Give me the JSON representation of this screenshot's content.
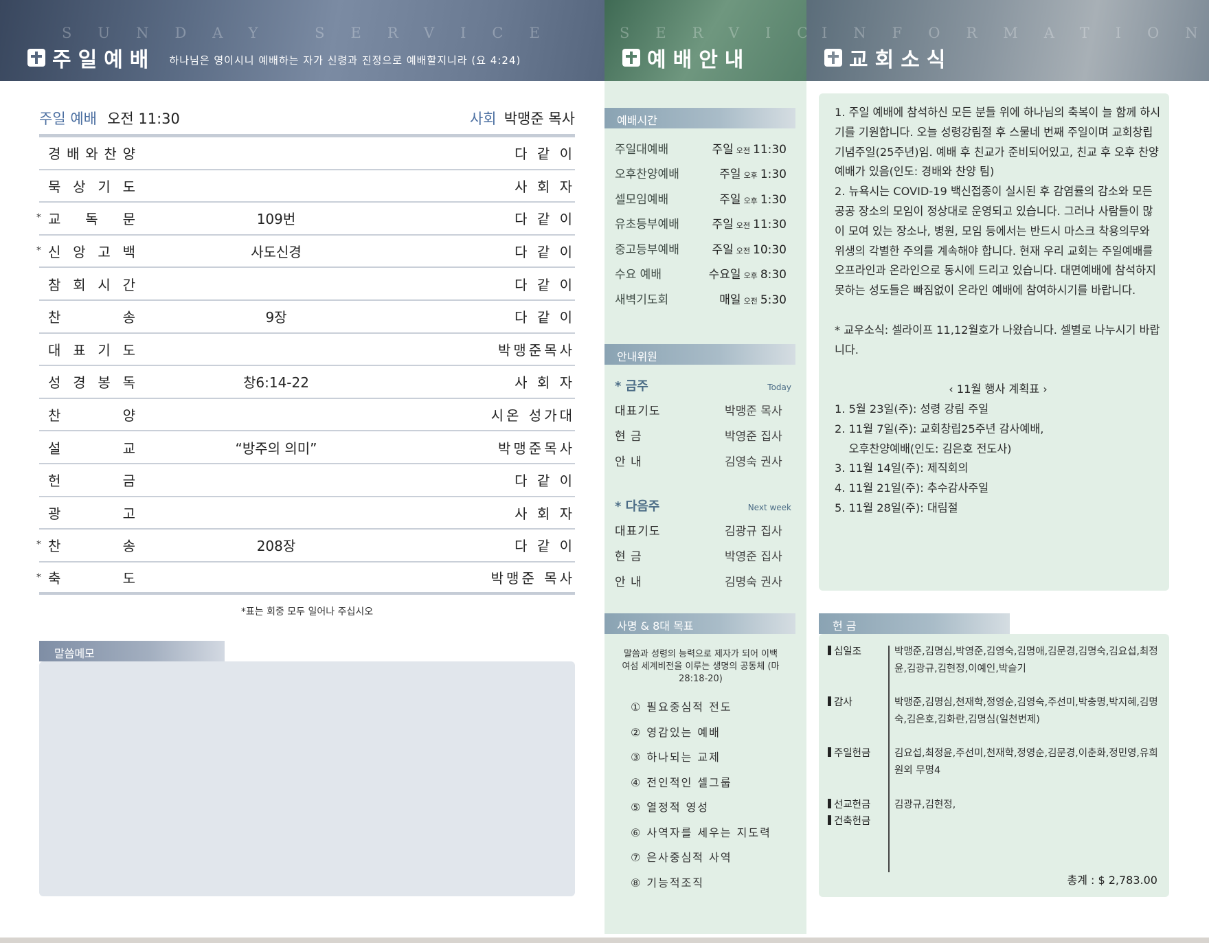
{
  "header": {
    "worship": {
      "deco": "SUNDAY SERVICE",
      "title": "주일예배",
      "subtitle": "하나님은 영이시니 예배하는 자가 신령과 진정으로 예배할지니라 (요 4:24)"
    },
    "guide": {
      "deco": "SERVICE",
      "title": "예배안내"
    },
    "news": {
      "deco": "INFORMATION",
      "title": "교회소식"
    }
  },
  "worship": {
    "service_label": "주일 예배",
    "service_time": "오전 11:30",
    "host_label": "사회",
    "host_name": "박맹준 목사",
    "order": [
      {
        "star": "",
        "name": [
          "경",
          "배",
          "와",
          " 찬",
          "양"
        ],
        "mid": "",
        "right": "다 같 이"
      },
      {
        "star": "",
        "name": [
          "묵",
          "상",
          "기",
          "도"
        ],
        "mid": "",
        "right": "사 회 자"
      },
      {
        "star": "*",
        "name": [
          "교",
          "독",
          "문"
        ],
        "mid": "109번",
        "right": "다 같 이"
      },
      {
        "star": "*",
        "name": [
          "신",
          "앙",
          "고",
          "백"
        ],
        "mid": "사도신경",
        "right": "다 같 이"
      },
      {
        "star": "",
        "name": [
          "참",
          "회",
          "시",
          "간"
        ],
        "mid": "",
        "right": "다 같 이"
      },
      {
        "star": "",
        "name": [
          "찬",
          "송"
        ],
        "mid": "9장",
        "right": "다 같 이"
      },
      {
        "star": "",
        "name": [
          "대",
          "표",
          "기",
          "도"
        ],
        "mid": "",
        "right": "박맹준목사"
      },
      {
        "star": "",
        "name": [
          "성",
          "경",
          "봉",
          "독"
        ],
        "mid": "창6:14-22",
        "right": "사 회 자"
      },
      {
        "star": "",
        "name": [
          "찬",
          "양"
        ],
        "mid": "",
        "right": "시온 성가대"
      },
      {
        "star": "",
        "name": [
          "설",
          "교"
        ],
        "mid": "“방주의 의미”",
        "right": "박맹준목사"
      },
      {
        "star": "",
        "name": [
          "헌",
          "금"
        ],
        "mid": "",
        "right": "다  같 이"
      },
      {
        "star": "",
        "name": [
          "광",
          "고"
        ],
        "mid": "",
        "right": "사 회 자"
      },
      {
        "star": "*",
        "name": [
          "찬",
          "송"
        ],
        "mid": "208장",
        "right": "다 같 이"
      },
      {
        "star": "*",
        "name": [
          "축",
          "도"
        ],
        "mid": "",
        "right": "박맹준 목사"
      }
    ],
    "note": "*표는 회중 모두 일어나 주십시오",
    "memo_label": "말씀메모"
  },
  "guide": {
    "time_label": "예배시간",
    "times": [
      {
        "name": "주일대예배",
        "day": "주일",
        "ampm": "오전",
        "time": "11:30"
      },
      {
        "name": "오후찬양예배",
        "day": "주일",
        "ampm": "오후",
        "time": "1:30"
      },
      {
        "name": "셀모임예배",
        "day": "주일",
        "ampm": "오후",
        "time": "1:30"
      },
      {
        "name": "유초등부예배",
        "day": "주일",
        "ampm": "오전",
        "time": "11:30"
      },
      {
        "name": "중고등부예배",
        "day": "주일",
        "ampm": "오전",
        "time": "10:30"
      },
      {
        "name": "수요 예배",
        "day": "수요일",
        "ampm": "오후",
        "time": "8:30"
      },
      {
        "name": "새벽기도회",
        "day": "매일",
        "ampm": "오전",
        "time": "5:30"
      }
    ],
    "duty_label": "안내위원",
    "this_week": {
      "label": "* 금주",
      "tag": "Today",
      "rows": [
        {
          "role": "대표기도",
          "name": "박맹준 목사"
        },
        {
          "role": "현    금",
          "name": "박영준 집사"
        },
        {
          "role": "안    내",
          "name": "김영숙 권사"
        }
      ]
    },
    "next_week": {
      "label": "* 다음주",
      "tag": "Next week",
      "rows": [
        {
          "role": "대표기도",
          "name": "김광규 집사"
        },
        {
          "role": "현    금",
          "name": "박영준 집사"
        },
        {
          "role": "안    내",
          "name": "김명숙 권사"
        }
      ]
    },
    "mission_label": "사명 & 8대 목표",
    "mission_text": "말씀과 성령의 능력으로 제자가 되어 이백 여섬 세계비전을 이루는 생명의 공동체 (마 28:18-20)",
    "goals": [
      "① 필요중심적 전도",
      "② 영감있는 예배",
      "③ 하나되는 교제",
      "④ 전인적인 셀그룹",
      "⑤ 열정적 영성",
      "⑥ 사역자를 세우는 지도력",
      "⑦ 은사중심적 사역",
      "⑧ 기능적조직"
    ]
  },
  "news": {
    "paragraphs": [
      "1. 주일 예배에 참석하신 모든 분들 위에 하나님의 축복이 늘 함께 하시기를 기원합니다. 오늘 성령강림절 후 스물네 번째 주일이며 교회창립기념주일(25주년)임. 예배 후 친교가 준비되어있고, 친교 후 오후 찬양예배가 있음(인도: 경배와 찬양 팀)",
      "2. 뉴욕시는 COVID-19 백신접종이 실시된 후 감염률의 감소와 모든 공공 장소의 모임이 정상대로 운영되고 있습니다. 그러나 사람들이 많이 모여 있는 장소나, 병원, 모임 등에서는 반드시 마스크 착용의무와 위생의 각별한 주의를 계속해야 합니다. 현재 우리 교회는 주일예배를 오프라인과 온라인으로 동시에 드리고 있습니다. 대면예배에 참석하지 못하는 성도들은 빠짐없이 온라인 예배에 참여하시기를 바랍니다."
    ],
    "alumni": "* 교우소식: 셀라이프 11,12월호가 나왔습니다. 셀별로 나누시기 바랍니다.",
    "plan_title": "‹  11월 행사 계획표  ›",
    "plan": [
      "1. 5월 23일(주): 성령 강림 주일",
      "2. 11월 7일(주): 교회창립25주년 감사예배,",
      "    오후찬양예배(인도: 김은호 전도사)",
      "3. 11월 14일(주): 제직회의",
      "4. 11월 21일(주): 추수감사주일",
      "5. 11월 28일(주): 대림절"
    ],
    "offering_label": "헌  금",
    "offerings": [
      {
        "cat": "십일조",
        "names": "박맹준,김명심,박영준,김영숙,김명애,김문경,김명숙,김요섭,최정윤,김광규,김현정,이예인,박슬기"
      },
      {
        "cat": "감사",
        "names": "박맹준,김명심,천재학,정영순,김영숙,주선미,박충명,박지혜,김명숙,김은호,김화란,김명심(일천번제)"
      },
      {
        "cat": "주일헌금",
        "names": "김요섭,최정윤,주선미,천재학,정영순,김문경,이춘화,정민영,유희원외 무명4"
      },
      {
        "cat": "선교헌금",
        "names": "김광규,김현정,"
      },
      {
        "cat": "건축헌금",
        "names": ""
      }
    ],
    "total": "총계 :  $  2,783.00"
  }
}
